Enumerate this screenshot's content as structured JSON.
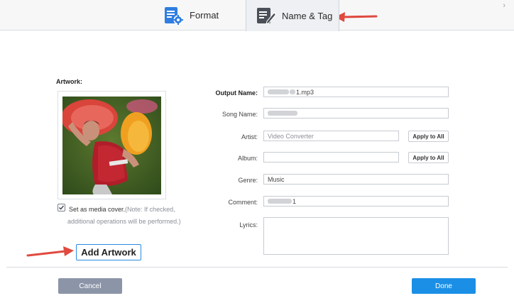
{
  "tabs": {
    "format": {
      "label": "Format",
      "icon": "format-settings-icon"
    },
    "name_tag": {
      "label": "Name & Tag",
      "icon": "edit-tag-icon",
      "selected": true
    }
  },
  "artwork": {
    "heading": "Artwork:",
    "set_cover_label": "Set as media cover.",
    "set_cover_note": "(Note: If checked, additional operations will be performed.)",
    "set_cover_checked": true,
    "add_button": "Add Artwork"
  },
  "form": {
    "output_name": {
      "label": "Output Name:",
      "value": "1.mp3"
    },
    "song_name": {
      "label": "Song Name:",
      "value": ""
    },
    "artist": {
      "label": "Artist:",
      "value": "Video Converter",
      "apply": "Apply to All"
    },
    "album": {
      "label": "Album:",
      "value": "",
      "apply": "Apply to All"
    },
    "genre": {
      "label": "Genre:",
      "value": "Music"
    },
    "comment": {
      "label": "Comment:",
      "value": "1"
    },
    "lyrics": {
      "label": "Lyrics:",
      "value": ""
    }
  },
  "footer": {
    "cancel": "Cancel",
    "done": "Done"
  },
  "colors": {
    "accent": "#1b8fe6",
    "cancel": "#8c95a8",
    "annotation_arrow": "#e04a3f"
  }
}
